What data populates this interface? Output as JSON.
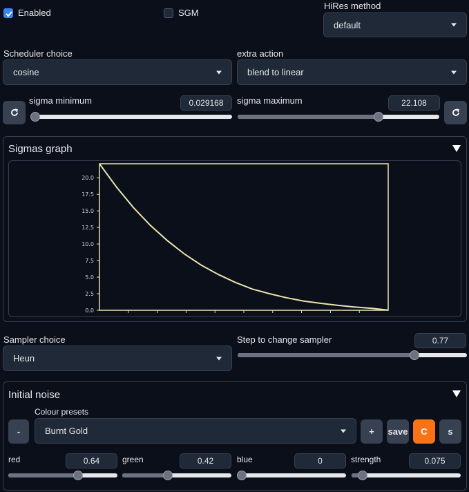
{
  "top": {
    "enabled_label": "Enabled",
    "enabled_checked": true,
    "sgm_label": "SGM",
    "sgm_checked": false,
    "hires_label": "HiRes method",
    "hires_value": "default"
  },
  "scheduler": {
    "label": "Scheduler choice",
    "value": "cosine",
    "extra_label": "extra action",
    "extra_value": "blend to linear"
  },
  "sigma": {
    "min_label": "sigma minimum",
    "min_value": "0.029168",
    "min_fraction": 0.0,
    "max_label": "sigma maximum",
    "max_value": "22.108",
    "max_fraction": 0.7
  },
  "graph": {
    "title": "Sigmas graph",
    "y_ticks": [
      "20.0",
      "17.5",
      "15.0",
      "12.5",
      "10.0",
      "7.5",
      "5.0",
      "2.5",
      "0.0"
    ],
    "line_color": "#e8e4b0"
  },
  "chart_data": {
    "type": "line",
    "title": "",
    "xlabel": "",
    "ylabel": "",
    "ylim": [
      0,
      22.108
    ],
    "x_tick_count": 9,
    "y_ticks": [
      20.0,
      17.5,
      15.0,
      12.5,
      10.0,
      7.5,
      5.0,
      2.5,
      0.0
    ],
    "series": [
      {
        "values": [
          22.108,
          18.6,
          15.5,
          12.8,
          10.5,
          8.5,
          6.8,
          5.4,
          4.2,
          3.2,
          2.5,
          1.9,
          1.4,
          1.05,
          0.75,
          0.5,
          0.3,
          0.029168
        ]
      }
    ]
  },
  "sampler": {
    "label": "Sampler choice",
    "value": "Heun",
    "step_label": "Step to change sampler",
    "step_value": "0.77",
    "step_fraction": 0.77
  },
  "noise": {
    "title": "Initial noise",
    "presets_label": "Colour presets",
    "preset_value": "Burnt Gold",
    "minus_label": "-",
    "plus_label": "+",
    "save_label": "save",
    "c_label": "C",
    "s_label": "s",
    "accent": "#f97316",
    "red_label": "red",
    "red_value": "0.64",
    "red_fraction": 0.64,
    "green_label": "green",
    "green_value": "0.42",
    "green_fraction": 0.42,
    "blue_label": "blue",
    "blue_value": "0",
    "blue_fraction": 0.0,
    "strength_label": "strength",
    "strength_value": "0.075",
    "strength_fraction": 0.1
  }
}
